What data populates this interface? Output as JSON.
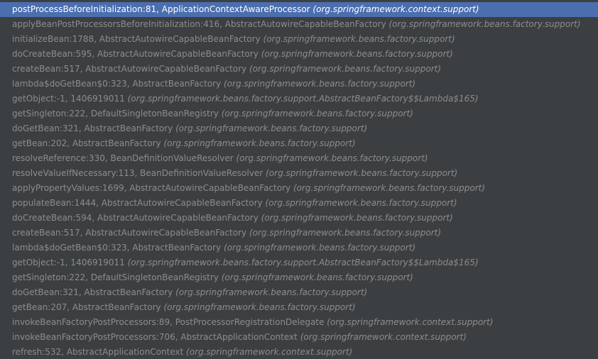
{
  "frames": [
    {
      "method": "postProcessBeforeInitialization:81, ApplicationContextAwareProcessor",
      "pkg": "(org.springframework.context.support)",
      "selected": true
    },
    {
      "method": "applyBeanPostProcessorsBeforeInitialization:416, AbstractAutowireCapableBeanFactory",
      "pkg": "(org.springframework.beans.factory.support)",
      "selected": false
    },
    {
      "method": "initializeBean:1788, AbstractAutowireCapableBeanFactory",
      "pkg": "(org.springframework.beans.factory.support)",
      "selected": false
    },
    {
      "method": "doCreateBean:595, AbstractAutowireCapableBeanFactory",
      "pkg": "(org.springframework.beans.factory.support)",
      "selected": false
    },
    {
      "method": "createBean:517, AbstractAutowireCapableBeanFactory",
      "pkg": "(org.springframework.beans.factory.support)",
      "selected": false
    },
    {
      "method": "lambda$doGetBean$0:323, AbstractBeanFactory",
      "pkg": "(org.springframework.beans.factory.support)",
      "selected": false
    },
    {
      "method": "getObject:-1, 1406919011",
      "pkg": "(org.springframework.beans.factory.support.AbstractBeanFactory$$Lambda$165)",
      "selected": false
    },
    {
      "method": "getSingleton:222, DefaultSingletonBeanRegistry",
      "pkg": "(org.springframework.beans.factory.support)",
      "selected": false
    },
    {
      "method": "doGetBean:321, AbstractBeanFactory",
      "pkg": "(org.springframework.beans.factory.support)",
      "selected": false
    },
    {
      "method": "getBean:202, AbstractBeanFactory",
      "pkg": "(org.springframework.beans.factory.support)",
      "selected": false
    },
    {
      "method": "resolveReference:330, BeanDefinitionValueResolver",
      "pkg": "(org.springframework.beans.factory.support)",
      "selected": false
    },
    {
      "method": "resolveValueIfNecessary:113, BeanDefinitionValueResolver",
      "pkg": "(org.springframework.beans.factory.support)",
      "selected": false
    },
    {
      "method": "applyPropertyValues:1699, AbstractAutowireCapableBeanFactory",
      "pkg": "(org.springframework.beans.factory.support)",
      "selected": false
    },
    {
      "method": "populateBean:1444, AbstractAutowireCapableBeanFactory",
      "pkg": "(org.springframework.beans.factory.support)",
      "selected": false
    },
    {
      "method": "doCreateBean:594, AbstractAutowireCapableBeanFactory",
      "pkg": "(org.springframework.beans.factory.support)",
      "selected": false
    },
    {
      "method": "createBean:517, AbstractAutowireCapableBeanFactory",
      "pkg": "(org.springframework.beans.factory.support)",
      "selected": false
    },
    {
      "method": "lambda$doGetBean$0:323, AbstractBeanFactory",
      "pkg": "(org.springframework.beans.factory.support)",
      "selected": false
    },
    {
      "method": "getObject:-1, 1406919011",
      "pkg": "(org.springframework.beans.factory.support.AbstractBeanFactory$$Lambda$165)",
      "selected": false
    },
    {
      "method": "getSingleton:222, DefaultSingletonBeanRegistry",
      "pkg": "(org.springframework.beans.factory.support)",
      "selected": false
    },
    {
      "method": "doGetBean:321, AbstractBeanFactory",
      "pkg": "(org.springframework.beans.factory.support)",
      "selected": false
    },
    {
      "method": "getBean:207, AbstractBeanFactory",
      "pkg": "(org.springframework.beans.factory.support)",
      "selected": false
    },
    {
      "method": "invokeBeanFactoryPostProcessors:89, PostProcessorRegistrationDelegate",
      "pkg": "(org.springframework.context.support)",
      "selected": false
    },
    {
      "method": "invokeBeanFactoryPostProcessors:706, AbstractApplicationContext",
      "pkg": "(org.springframework.context.support)",
      "selected": false
    },
    {
      "method": "refresh:532, AbstractApplicationContext",
      "pkg": "(org.springframework.context.support)",
      "selected": false
    }
  ],
  "colors": {
    "background": "#3c3f41",
    "text": "#8c8c8c",
    "selection": "#4b6eaf",
    "selected_text": "#ffffff"
  }
}
